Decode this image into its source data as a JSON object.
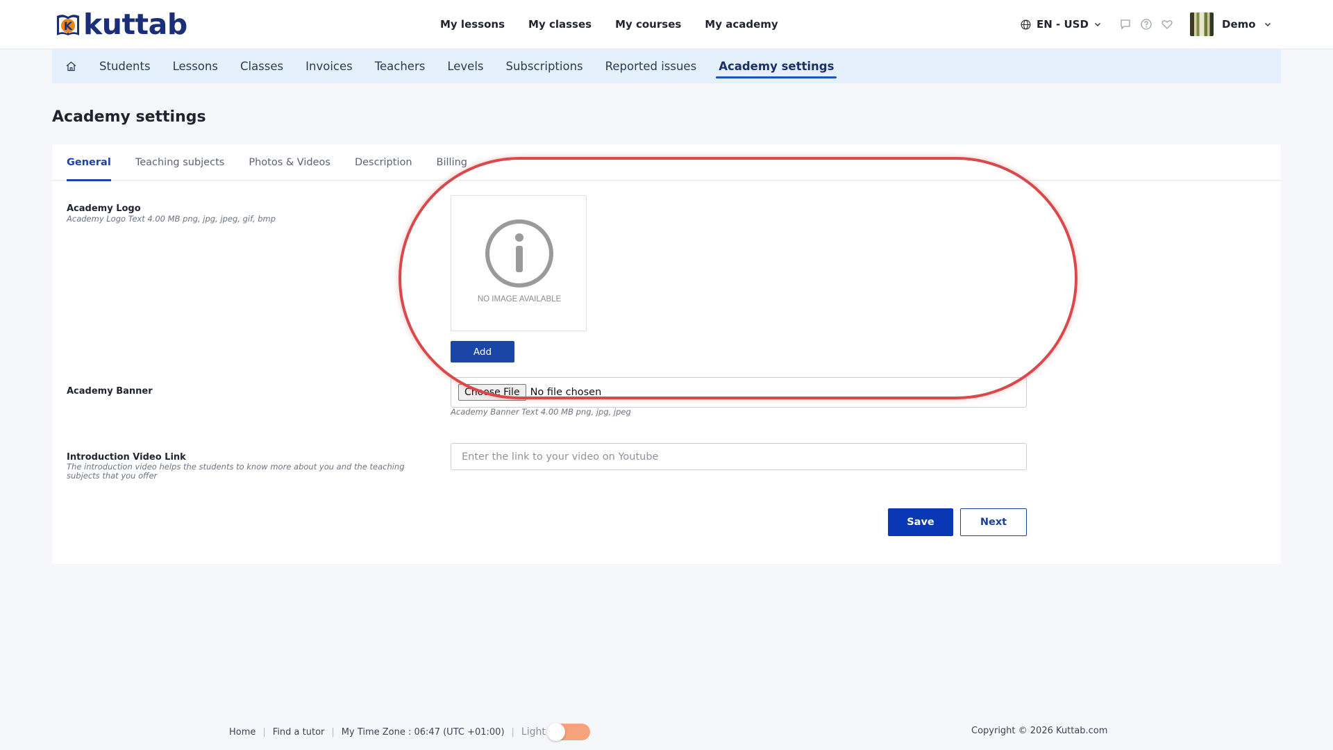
{
  "header": {
    "logo_text": "kuttab",
    "logo_letter": "K",
    "nav": [
      "My lessons",
      "My classes",
      "My courses",
      "My academy"
    ],
    "language": "EN - USD",
    "user_name": "Demo",
    "icons": [
      "chat-icon",
      "help-icon",
      "heart-icon"
    ]
  },
  "subnav": {
    "items": [
      "Students",
      "Lessons",
      "Classes",
      "Invoices",
      "Teachers",
      "Levels",
      "Subscriptions",
      "Reported issues",
      "Academy settings"
    ],
    "active": "Academy settings"
  },
  "page": {
    "title": "Academy settings"
  },
  "tabs": {
    "items": [
      "General",
      "Teaching subjects",
      "Photos & Videos",
      "Description",
      "Billing"
    ],
    "active": "General"
  },
  "form": {
    "logo_label": "Academy Logo",
    "logo_help": "Academy Logo Text 4.00 MB png, jpg, jpeg, gif, bmp",
    "no_image_text": "NO IMAGE AVAILABLE",
    "add_label": "Add",
    "banner_label": "Academy Banner",
    "choose_file_label": "Choose File",
    "file_status": "No file chosen",
    "banner_help": "Academy Banner Text 4.00 MB png, jpg, jpeg",
    "video_label": "Introduction Video Link",
    "video_help": "The introduction video helps the students to know more about you and the teaching subjects that you offer",
    "video_placeholder": "Enter the link to your video on Youtube",
    "video_value": "",
    "save_label": "Save",
    "next_label": "Next"
  },
  "footer": {
    "home": "Home",
    "find_tutor": "Find a tutor",
    "timezone": "My Time Zone : 06:47 (UTC +01:00)",
    "theme_label": "Light",
    "copyright": "Copyright © 2026 Kuttab.com"
  },
  "colors": {
    "primary": "#0a37b3",
    "accent_tab": "#1b44a6",
    "subnav_bg": "#e4f0fb",
    "annotation": "#d9484a",
    "toggle": "#f6a27a"
  }
}
